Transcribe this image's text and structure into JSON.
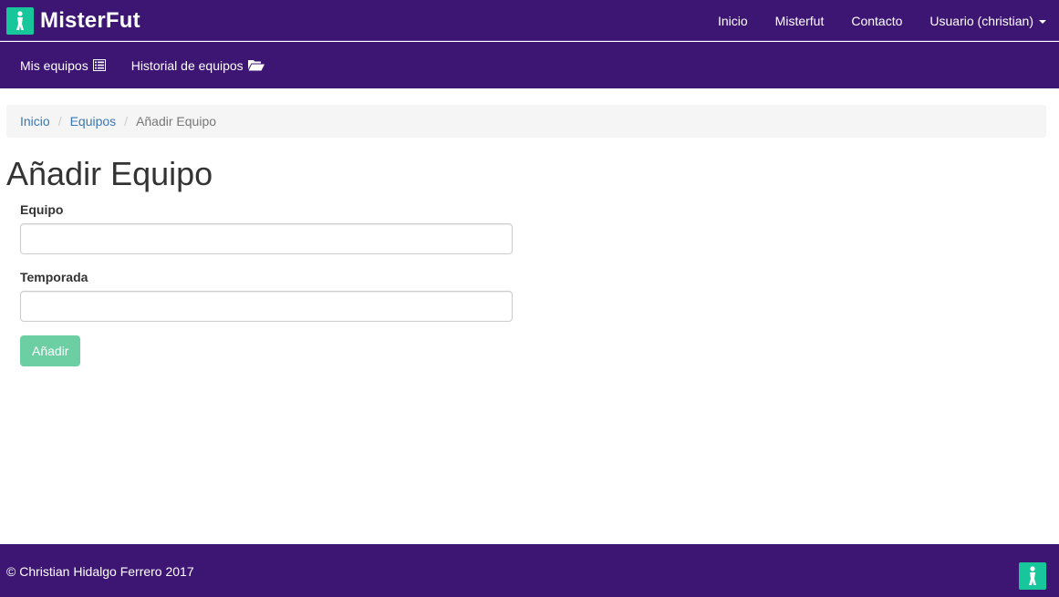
{
  "brand": {
    "name": "MisterFut",
    "logo_icon": "player-figure-icon",
    "logo_color": "#17c79b"
  },
  "theme": {
    "navbar_bg": "#3d1673",
    "link_color": "#3a78b5",
    "button_bg": "#6bcfa3"
  },
  "top_nav": {
    "inicio": "Inicio",
    "misterfut": "Misterfut",
    "contacto": "Contacto",
    "usuario": "Usuario (christian)"
  },
  "sub_nav": {
    "mis_equipos": "Mis equipos",
    "mis_equipos_icon": "list-icon",
    "historial": "Historial de equipos",
    "historial_icon": "folder-open-icon"
  },
  "breadcrumb": {
    "items": [
      "Inicio",
      "Equipos"
    ],
    "current": "Añadir Equipo",
    "separator": "/"
  },
  "page": {
    "title": "Añadir Equipo"
  },
  "form": {
    "equipo_label": "Equipo",
    "equipo_value": "",
    "temporada_label": "Temporada",
    "temporada_value": "",
    "submit_label": "Añadir"
  },
  "footer": {
    "copyright": "© Christian Hidalgo Ferrero 2017"
  }
}
